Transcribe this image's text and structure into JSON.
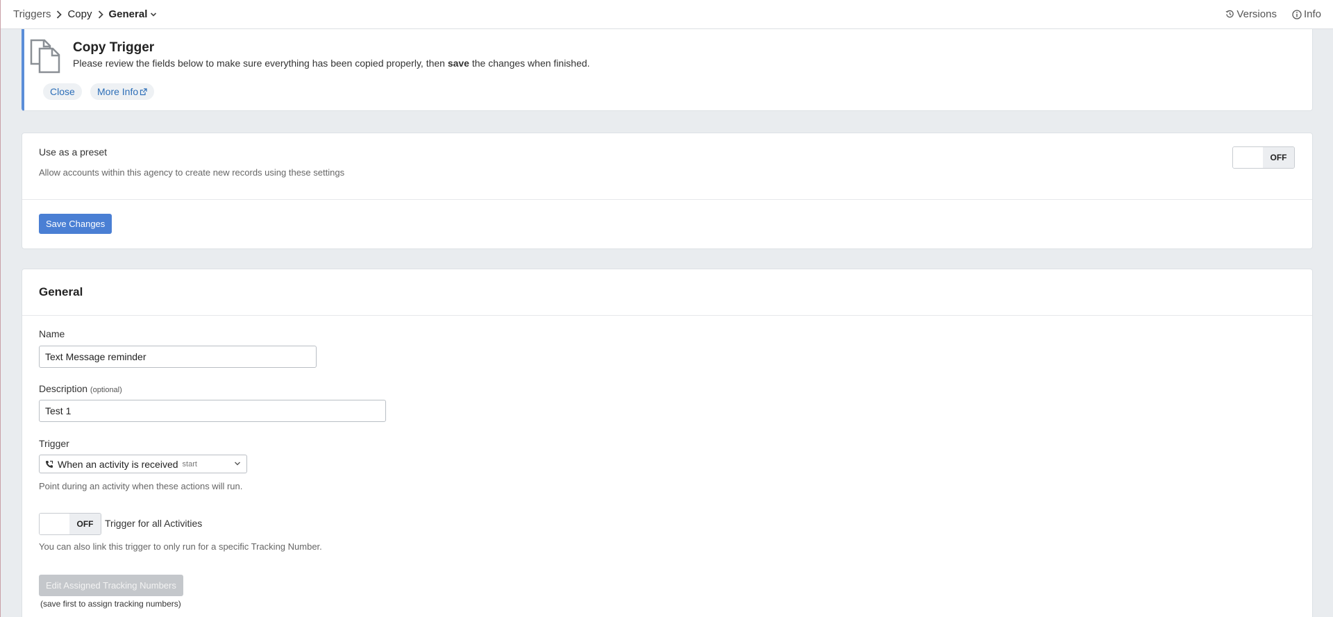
{
  "breadcrumb": {
    "items": [
      "Triggers",
      "Copy"
    ],
    "current": "General"
  },
  "topbar": {
    "versions_label": "Versions",
    "info_label": "Info"
  },
  "notice": {
    "title": "Copy Trigger",
    "message_before": "Please review the fields below to make sure everything has been copied properly, then ",
    "message_bold": "save",
    "message_after": " the changes when finished.",
    "close_label": "Close",
    "more_info_label": "More Info"
  },
  "preset": {
    "label": "Use as a preset",
    "help": "Allow accounts within this agency to create new records using these settings",
    "toggle_state": "OFF",
    "save_label": "Save Changes"
  },
  "general": {
    "title": "General",
    "name_label": "Name",
    "name_value": "Text Message reminder",
    "description_label": "Description",
    "description_optional": "(optional)",
    "description_value": "Test 1",
    "trigger_label": "Trigger",
    "trigger_value": "When an activity is received",
    "trigger_sub": "start",
    "trigger_help": "Point during an activity when these actions will run.",
    "all_activities_toggle": "OFF",
    "all_activities_label": "Trigger for all Activities",
    "link_help": "You can also link this trigger to only run for a specific Tracking Number.",
    "edit_tracking_label": "Edit Assigned Tracking Numbers",
    "save_first_note": "(save first to assign tracking numbers)"
  },
  "colors": {
    "accent": "#4a7fd4",
    "link": "#2e6fb8",
    "notice_border": "#5b8ed8",
    "page_bg": "#e9ecef"
  }
}
